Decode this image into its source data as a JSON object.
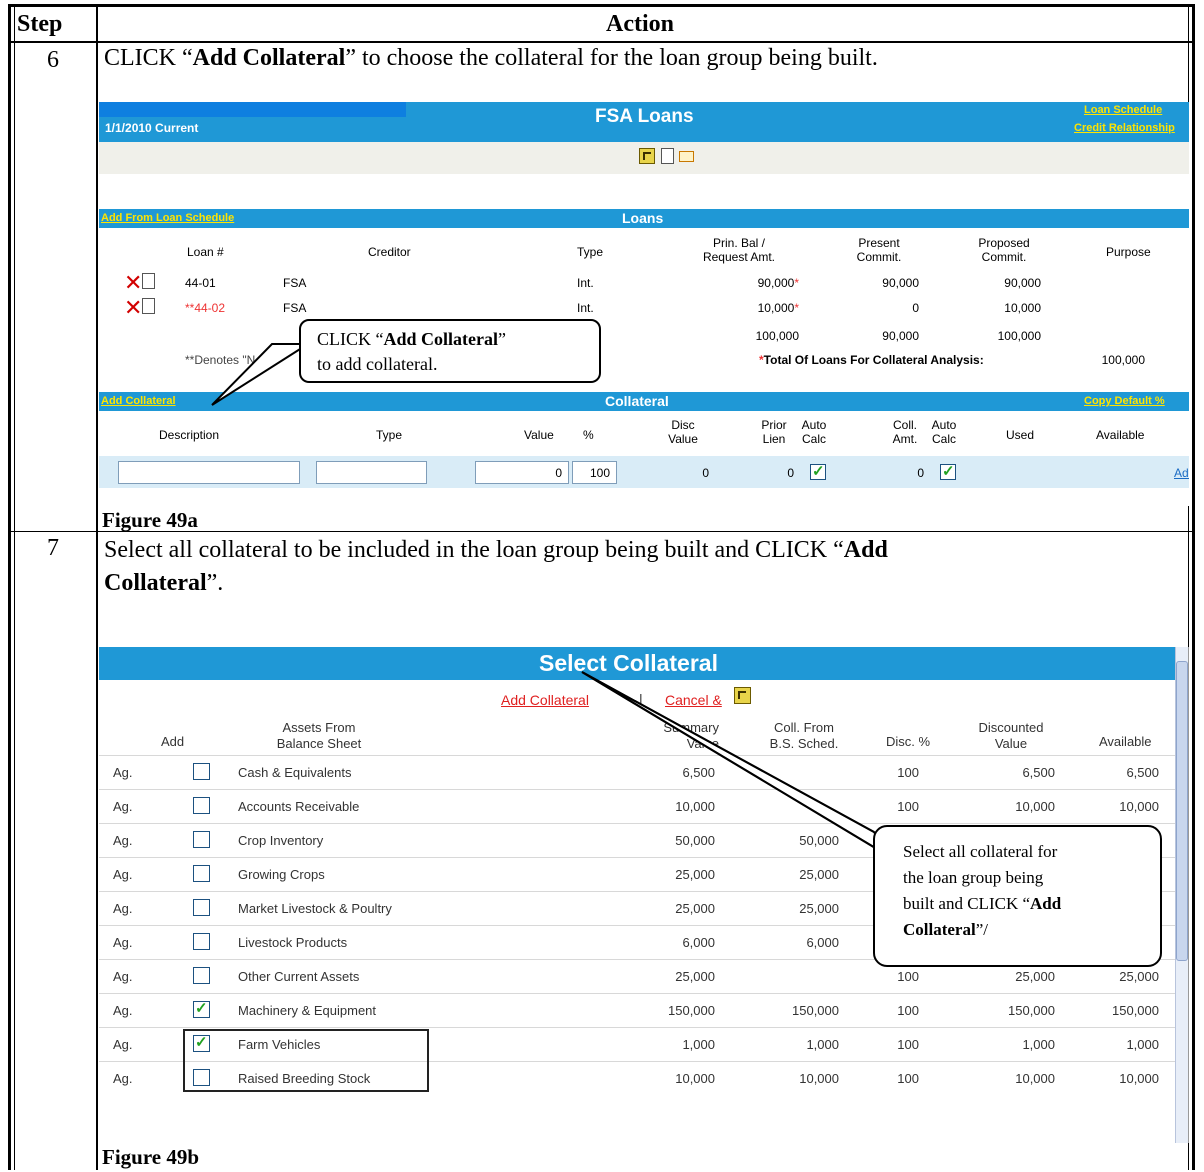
{
  "table": {
    "col_step": "Step",
    "col_action": "Action"
  },
  "step6": {
    "num": "6",
    "pre": "CLICK “",
    "bold": "Add Collateral",
    "post": "” to choose the collateral for the loan group being built."
  },
  "step7": {
    "num": "7",
    "pre": "Select all collateral to be included in the loan group being built and CLICK “",
    "bold1": "Add",
    "bold2": "Collateral",
    "post": "”."
  },
  "fig49a": {
    "caption": "Figure 49a",
    "date": "1/1/2010 Current",
    "title": "FSA Loans",
    "link_schedule": "Loan Schedule",
    "link_credit": "Credit Relationship",
    "loans": {
      "add_from_link": "Add From Loan Schedule",
      "section": "Loans",
      "headers": {
        "loan": "Loan #",
        "creditor": "Creditor",
        "type": "Type",
        "prin1": "Prin. Bal /",
        "prin2": "Request Amt.",
        "present1": "Present",
        "present2": "Commit.",
        "proposed1": "Proposed",
        "proposed2": "Commit.",
        "purpose": "Purpose"
      },
      "rows": [
        {
          "loan": "44-01",
          "creditor": "FSA",
          "type": "Int.",
          "prin": "90,000",
          "star": "*",
          "present": "90,000",
          "proposed": "90,000"
        },
        {
          "loan": "**44-02",
          "creditor": "FSA",
          "type": "Int.",
          "prin": "10,000",
          "star": "*",
          "present": "0",
          "proposed": "10,000"
        }
      ],
      "totals": {
        "prin": "100,000",
        "present": "90,000",
        "proposed": "100,000"
      },
      "denotes": "**Denotes \"N",
      "total_star": "*",
      "total_label": "Total Of Loans For Collateral Analysis:",
      "total_value": "100,000"
    },
    "collateral": {
      "add_link": "Add Collateral",
      "section": "Collateral",
      "copy_link": "Copy Default %",
      "headers": {
        "desc": "Description",
        "type": "Type",
        "value": "Value",
        "pct": "%",
        "disc1": "Disc",
        "disc2": "Value",
        "prior1": "Prior",
        "prior2": "Lien",
        "auto1": "Auto",
        "auto2": "Calc",
        "coll1": "Coll.",
        "coll2": "Amt.",
        "auto3": "Auto",
        "auto4": "Calc",
        "used": "Used",
        "available": "Available"
      },
      "row": {
        "value": "0",
        "pct": "100",
        "disc": "0",
        "prior": "0",
        "coll": "0",
        "link": "Add"
      }
    },
    "callout": {
      "pre": "CLICK “",
      "bold": "Add Collateral",
      "post": "”",
      "line2": "to add collateral."
    }
  },
  "fig49b": {
    "caption": "Figure 49b",
    "title": "Select Collateral",
    "link_add": "Add Collateral",
    "sep": "|",
    "link_cancel": "Cancel &",
    "headers": {
      "add": "Add",
      "assets1": "Assets From",
      "assets2": "Balance Sheet",
      "summary1": "Summary",
      "summary2": "Value",
      "coll1": "Coll. From",
      "coll2": "B.S. Sched.",
      "disc": "Disc. %",
      "discounted1": "Discounted",
      "discounted2": "Value",
      "available": "Available"
    },
    "rows": [
      {
        "cat": "Ag.",
        "checked": false,
        "asset": "Cash & Equivalents",
        "summary": "6,500",
        "coll": "",
        "disc": "100",
        "discounted": "6,500",
        "available": "6,500"
      },
      {
        "cat": "Ag.",
        "checked": false,
        "asset": "Accounts Receivable",
        "summary": "10,000",
        "coll": "",
        "disc": "100",
        "discounted": "10,000",
        "available": "10,000"
      },
      {
        "cat": "Ag.",
        "checked": false,
        "asset": "Crop Inventory",
        "summary": "50,000",
        "coll": "50,000",
        "disc": "",
        "discounted": "",
        "available": ""
      },
      {
        "cat": "Ag.",
        "checked": false,
        "asset": "Growing Crops",
        "summary": "25,000",
        "coll": "25,000",
        "disc": "",
        "discounted": "",
        "available": ""
      },
      {
        "cat": "Ag.",
        "checked": false,
        "asset": "Market Livestock & Poultry",
        "summary": "25,000",
        "coll": "25,000",
        "disc": "",
        "discounted": "",
        "available": ""
      },
      {
        "cat": "Ag.",
        "checked": false,
        "asset": "Livestock Products",
        "summary": "6,000",
        "coll": "6,000",
        "disc": "",
        "discounted": "",
        "available": ""
      },
      {
        "cat": "Ag.",
        "checked": false,
        "asset": "Other Current Assets",
        "summary": "25,000",
        "coll": "",
        "disc": "100",
        "discounted": "25,000",
        "available": "25,000"
      },
      {
        "cat": "Ag.",
        "checked": true,
        "asset": "Machinery & Equipment",
        "summary": "150,000",
        "coll": "150,000",
        "disc": "100",
        "discounted": "150,000",
        "available": "150,000"
      },
      {
        "cat": "Ag.",
        "checked": true,
        "asset": "Farm Vehicles",
        "summary": "1,000",
        "coll": "1,000",
        "disc": "100",
        "discounted": "1,000",
        "available": "1,000"
      },
      {
        "cat": "Ag.",
        "checked": false,
        "asset": "Raised Breeding Stock",
        "summary": "10,000",
        "coll": "10,000",
        "disc": "100",
        "discounted": "10,000",
        "available": "10,000"
      }
    ],
    "callout": {
      "l1": "Select all collateral for",
      "l2": "the loan group being",
      "l3pre": "built and CLICK “",
      "l3bold": "Add",
      "l4bold": "Collateral",
      "l4post": "”/"
    }
  }
}
